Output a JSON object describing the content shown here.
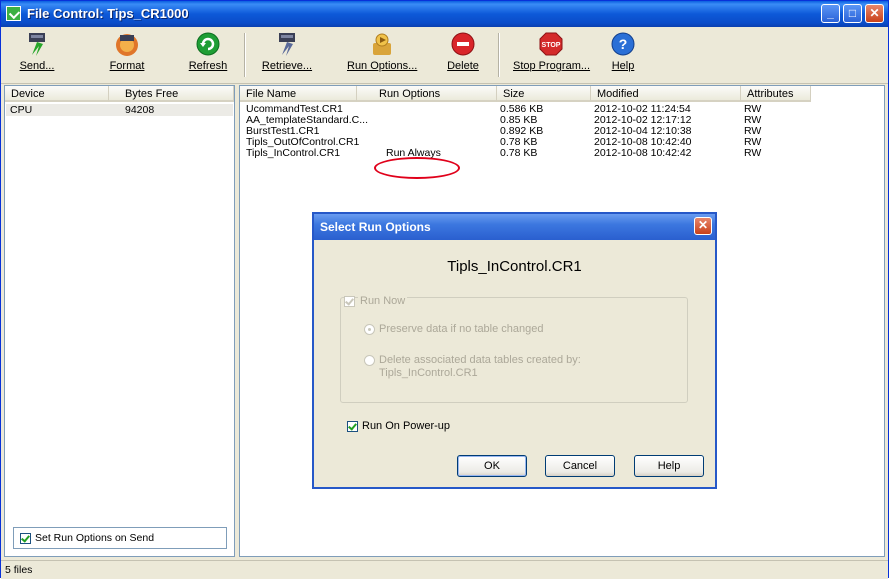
{
  "window": {
    "title": "File Control: Tips_CR1000",
    "icon": "file-control-icon"
  },
  "toolbar": {
    "send": "Send...",
    "format": "Format",
    "refresh": "Refresh",
    "retrieve": "Retrieve...",
    "run_options": "Run Options...",
    "delete": "Delete",
    "stop_program": "Stop Program...",
    "help": "Help"
  },
  "devices": {
    "headers": {
      "device": "Device",
      "bytes_free": "Bytes Free"
    },
    "rows": [
      {
        "device": "CPU",
        "bytes_free": "94208"
      }
    ]
  },
  "files": {
    "headers": {
      "name": "File Name",
      "run_options": "Run Options",
      "size": "Size",
      "modified": "Modified",
      "attributes": "Attributes"
    },
    "rows": [
      {
        "name": "UcommandTest.CR1",
        "run_options": "",
        "size": "0.586 KB",
        "modified": "2012-10-02 11:24:54",
        "attributes": "RW"
      },
      {
        "name": "AA_templateStandard.C...",
        "run_options": "",
        "size": "0.85 KB",
        "modified": "2012-10-02 12:17:12",
        "attributes": "RW"
      },
      {
        "name": "BurstTest1.CR1",
        "run_options": "",
        "size": "0.892 KB",
        "modified": "2012-10-04 12:10:38",
        "attributes": "RW"
      },
      {
        "name": "Tipls_OutOfControl.CR1",
        "run_options": "",
        "size": "0.78 KB",
        "modified": "2012-10-08 10:42:40",
        "attributes": "RW"
      },
      {
        "name": "Tipls_InControl.CR1",
        "run_options": "Run Always",
        "size": "0.78 KB",
        "modified": "2012-10-08 10:42:42",
        "attributes": "RW"
      }
    ]
  },
  "set_run_options_on_send": {
    "label": "Set Run Options on Send",
    "checked": true
  },
  "status": {
    "text": "5 files"
  },
  "dialog": {
    "title": "Select Run Options",
    "file_name": "Tipls_InControl.CR1",
    "run_now": {
      "label": "Run Now",
      "checked": true,
      "enabled": false
    },
    "preserve": {
      "label": "Preserve data if no table changed",
      "selected": true,
      "enabled": false
    },
    "delete_tables": {
      "label_line1": "Delete associated data tables created by:",
      "label_line2": "Tipls_InControl.CR1",
      "selected": false,
      "enabled": false
    },
    "run_on_powerup": {
      "label": "Run On Power-up",
      "checked": true
    },
    "ok": "OK",
    "cancel": "Cancel",
    "help": "Help"
  },
  "colors": {
    "titlebar": "#0a59d8",
    "highlight_circle": "#e0001a",
    "window_bg": "#ece9d8"
  }
}
